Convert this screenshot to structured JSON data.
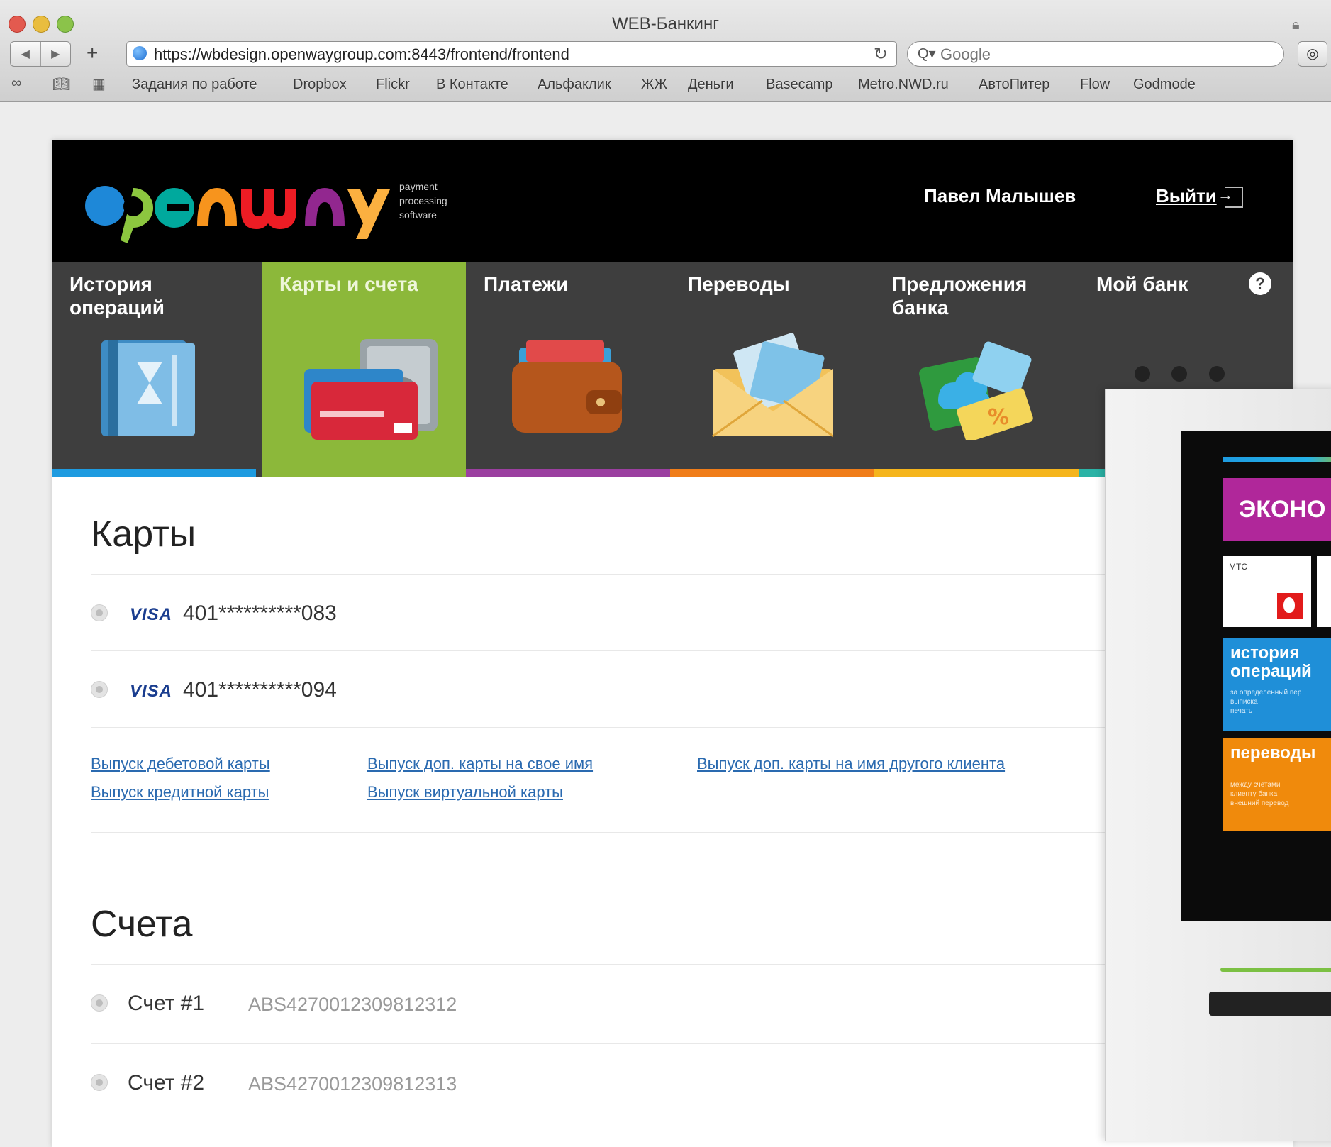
{
  "browser": {
    "window_title": "WEB-Банкинг",
    "url": "https://wbdesign.openwaygroup.com:8443/frontend/frontend",
    "search_placeholder": "Google",
    "bookmarks": [
      "Задания по работе",
      "Dropbox",
      "Flickr",
      "В Контакте",
      "Альфаклик",
      "ЖЖ",
      "Деньги",
      "Basecamp",
      "Metro.NWD.ru",
      "АвтоПитер",
      "Flow",
      "Godmode"
    ]
  },
  "header": {
    "logo_tagline": [
      "payment",
      "processing",
      "software"
    ],
    "user_name": "Павел Малышев",
    "logout_label": "Выйти"
  },
  "nav": {
    "tabs": [
      {
        "label": "История операций",
        "color": "#1e9be0",
        "active": false
      },
      {
        "label": "Карты и счета",
        "color": "#8cb83a",
        "active": true
      },
      {
        "label": "Платежи",
        "color": "#9b3fa0",
        "active": false
      },
      {
        "label": "Переводы",
        "color": "#f07d1a",
        "active": false
      },
      {
        "label": "Предложения банка",
        "color": "#f5b51d",
        "active": false
      },
      {
        "label": "Мой банк",
        "color": "#2bb3a6",
        "active": false
      }
    ],
    "help_label": "?"
  },
  "cards": {
    "title": "Карты",
    "items": [
      {
        "brand": "VISA",
        "number": "401**********083"
      },
      {
        "brand": "VISA",
        "number": "401**********094"
      }
    ],
    "links": [
      "Выпуск дебетовой карты",
      "Выпуск кредитной карты",
      "Выпуск доп. карты на свое имя",
      "Выпуск виртуальной карты",
      "Выпуск доп. карты на имя другого клиента"
    ]
  },
  "accounts": {
    "title": "Счета",
    "items": [
      {
        "name": "Счет #1",
        "number": "ABS4270012309812312"
      },
      {
        "name": "Счет #2",
        "number": "ABS4270012309812313"
      }
    ]
  },
  "kiosk": {
    "econom_label": "ЭКОНО",
    "mts_label": "МТС",
    "history_title": "история операций",
    "history_sub": [
      "за определенный пер",
      "выписка",
      "печать"
    ],
    "transfers_title": "переводы",
    "transfers_sub": [
      "между счетами",
      "клиенту банка",
      "внешний перевод"
    ]
  }
}
